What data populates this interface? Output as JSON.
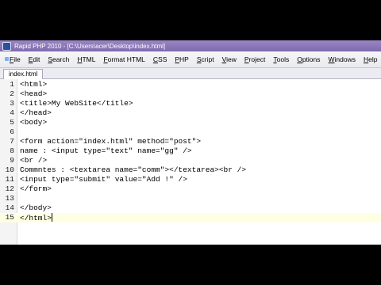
{
  "window": {
    "title": "Rapid PHP 2010 - [C:\\Users\\acer\\Desktop\\index.html]"
  },
  "menu": {
    "items": [
      {
        "label": "File"
      },
      {
        "label": "Edit"
      },
      {
        "label": "Search"
      },
      {
        "label": "HTML"
      },
      {
        "label": "Format HTML"
      },
      {
        "label": "CSS"
      },
      {
        "label": "PHP"
      },
      {
        "label": "Script"
      },
      {
        "label": "View"
      },
      {
        "label": "Project"
      },
      {
        "label": "Tools"
      },
      {
        "label": "Options"
      },
      {
        "label": "Windows"
      },
      {
        "label": "Help"
      }
    ]
  },
  "tabs": [
    {
      "label": "index.html"
    }
  ],
  "editor": {
    "current_line": 15,
    "lines": [
      {
        "num": "1",
        "text": "<html>"
      },
      {
        "num": "2",
        "text": "<head>"
      },
      {
        "num": "3",
        "text": "<title>My WebSite</title>"
      },
      {
        "num": "4",
        "text": "</head>"
      },
      {
        "num": "5",
        "text": "<body>"
      },
      {
        "num": "6",
        "text": ""
      },
      {
        "num": "7",
        "text": "<form action=\"index.html\" method=\"post\">"
      },
      {
        "num": "8",
        "text": "name : <input type=\"text\" name=\"gg\" />"
      },
      {
        "num": "9",
        "text": "<br />"
      },
      {
        "num": "10",
        "text": "Commntes : <textarea name=\"comm\"></textarea><br />"
      },
      {
        "num": "11",
        "text": "<input type=\"submit\" value=\"Add !\" />"
      },
      {
        "num": "12",
        "text": "</form>"
      },
      {
        "num": "13",
        "text": ""
      },
      {
        "num": "14",
        "text": "</body>"
      },
      {
        "num": "15",
        "text": "</html>"
      }
    ]
  },
  "colors": {
    "titlebar": "#8a76b8",
    "current_line_highlight": "#ffffe3",
    "gutter": "#f4f4f4"
  }
}
